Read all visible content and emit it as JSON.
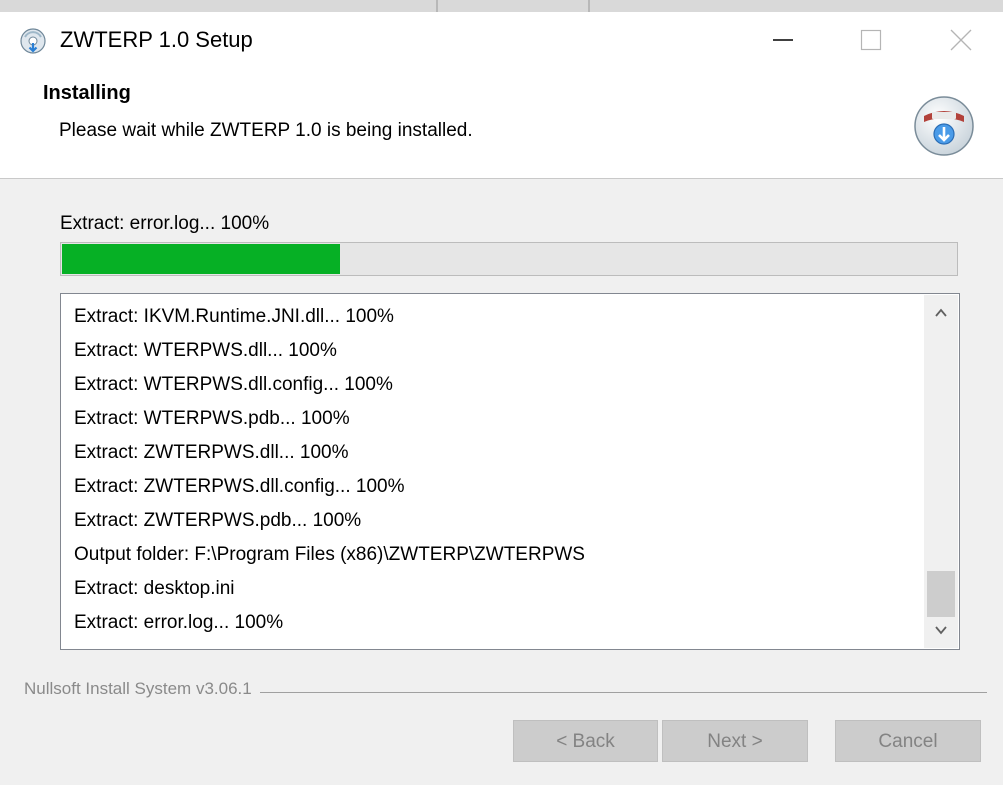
{
  "window": {
    "title": "ZWTERP 1.0 Setup",
    "controls": [
      "minimize",
      "maximize",
      "close"
    ]
  },
  "header": {
    "title": "Installing",
    "subtitle": "Please wait while ZWTERP 1.0 is being installed."
  },
  "progress": {
    "status": "Extract: error.log... 100%",
    "fraction": 0.31,
    "color": "#06b025"
  },
  "log": {
    "lines": [
      "Extract: IKVM.Runtime.JNI.dll... 100%",
      "Extract: WTERPWS.dll... 100%",
      "Extract: WTERPWS.dll.config... 100%",
      "Extract: WTERPWS.pdb... 100%",
      "Extract: ZWTERPWS.dll... 100%",
      "Extract: ZWTERPWS.dll.config... 100%",
      "Extract: ZWTERPWS.pdb... 100%",
      "Output folder: F:\\Program Files (x86)\\ZWTERP\\ZWTERPWS",
      "Extract: desktop.ini",
      "Extract: error.log... 100%"
    ]
  },
  "footer": {
    "brand": "Nullsoft Install System v3.06.1",
    "back_label": "< Back",
    "next_label": "Next >",
    "cancel_label": "Cancel"
  },
  "icons": {
    "app": "installer-disc-icon",
    "header": "nsis-installer-icon"
  }
}
